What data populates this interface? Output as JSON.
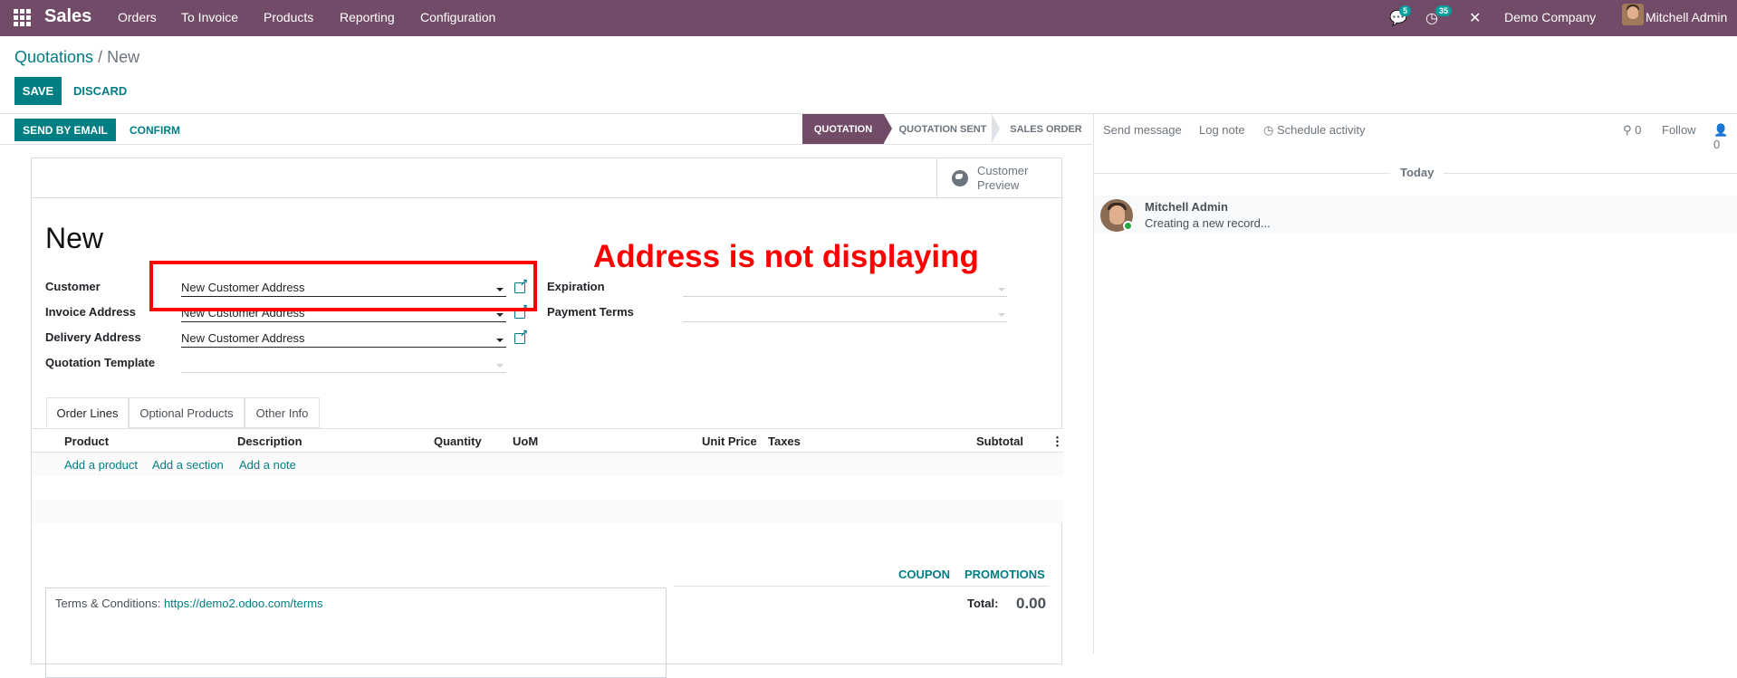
{
  "navbar": {
    "app_name": "Sales",
    "menu": [
      "Orders",
      "To Invoice",
      "Products",
      "Reporting",
      "Configuration"
    ],
    "messages_badge": "5",
    "activities_badge": "35",
    "company": "Demo Company",
    "user": "Mitchell Admin"
  },
  "breadcrumb": {
    "parent": "Quotations",
    "separator": "/",
    "current": "New"
  },
  "control": {
    "save": "SAVE",
    "discard": "DISCARD"
  },
  "header": {
    "send_email": "SEND BY EMAIL",
    "confirm": "CONFIRM",
    "stages": [
      "QUOTATION",
      "QUOTATION SENT",
      "SALES ORDER"
    ],
    "active_stage": "QUOTATION"
  },
  "smart_button": {
    "label_line1": "Customer",
    "label_line2": "Preview"
  },
  "form": {
    "title": "New",
    "customer_label": "Customer",
    "customer_value": "New Customer Address",
    "invoice_label": "Invoice Address",
    "invoice_value": "New Customer Address",
    "delivery_label": "Delivery Address",
    "delivery_value": "New Customer Address",
    "template_label": "Quotation Template",
    "template_value": "",
    "expiration_label": "Expiration",
    "expiration_value": "",
    "payment_label": "Payment Terms",
    "payment_value": ""
  },
  "annotation": {
    "text": "Address is not displaying",
    "color": "#ff0000"
  },
  "tabs": [
    "Order Lines",
    "Optional Products",
    "Other Info"
  ],
  "table": {
    "columns": [
      "Product",
      "Description",
      "Quantity",
      "UoM",
      "Unit Price",
      "Taxes",
      "Subtotal"
    ],
    "add_product": "Add a product",
    "add_section": "Add a section",
    "add_note": "Add a note"
  },
  "footer": {
    "coupon": "COUPON",
    "promotions": "PROMOTIONS",
    "total_label": "Total:",
    "total_value": "0.00",
    "terms_prefix": "Terms & Conditions:",
    "terms_link": "https://demo2.odoo.com/terms"
  },
  "chatter": {
    "send_message": "Send message",
    "log_note": "Log note",
    "schedule_activity": "Schedule activity",
    "attachments_count": "0",
    "follow": "Follow",
    "followers_count": "0",
    "date_separator": "Today",
    "message_author": "Mitchell Admin",
    "message_body": "Creating a new record..."
  },
  "colors": {
    "brand": "#714b67",
    "accent": "#017e84",
    "badge": "#00a09d"
  }
}
